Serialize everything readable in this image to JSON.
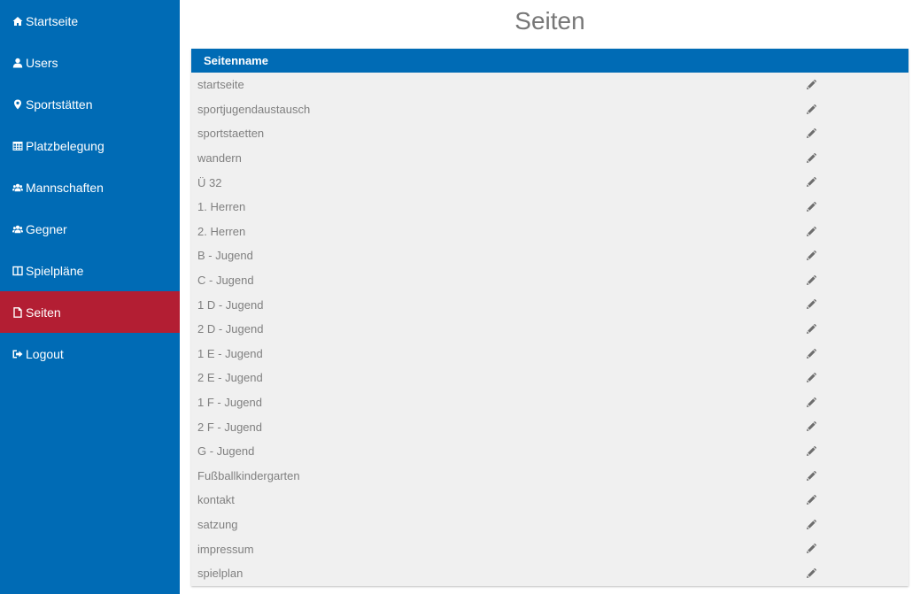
{
  "sidebar": {
    "items": [
      {
        "label": "Startseite",
        "icon": "home-icon"
      },
      {
        "label": "Users",
        "icon": "user-icon"
      },
      {
        "label": "Sportstätten",
        "icon": "map-marker-icon"
      },
      {
        "label": "Platzbelegung",
        "icon": "table-icon"
      },
      {
        "label": "Mannschaften",
        "icon": "users-icon"
      },
      {
        "label": "Gegner",
        "icon": "users-icon"
      },
      {
        "label": "Spielpläne",
        "icon": "columns-icon"
      },
      {
        "label": "Seiten",
        "icon": "file-icon",
        "active": true
      },
      {
        "label": "Logout",
        "icon": "sign-out-icon"
      }
    ],
    "background": "#006bb5",
    "active_background": "#b31e33"
  },
  "main": {
    "title": "Seiten",
    "table": {
      "header": "Seitenname",
      "edit_icon": "pencil-icon",
      "rows": [
        "startseite",
        "sportjugendaustausch",
        "sportstaetten",
        "wandern",
        "Ü 32",
        "1. Herren",
        "2. Herren",
        "B - Jugend",
        "C - Jugend",
        "1 D - Jugend",
        "2 D - Jugend",
        "1 E - Jugend",
        "2 E - Jugend",
        "1 F - Jugend",
        "2 F - Jugend",
        "G - Jugend",
        "Fußballkindergarten",
        "kontakt",
        "satzung",
        "impressum",
        "spielplan"
      ]
    }
  }
}
